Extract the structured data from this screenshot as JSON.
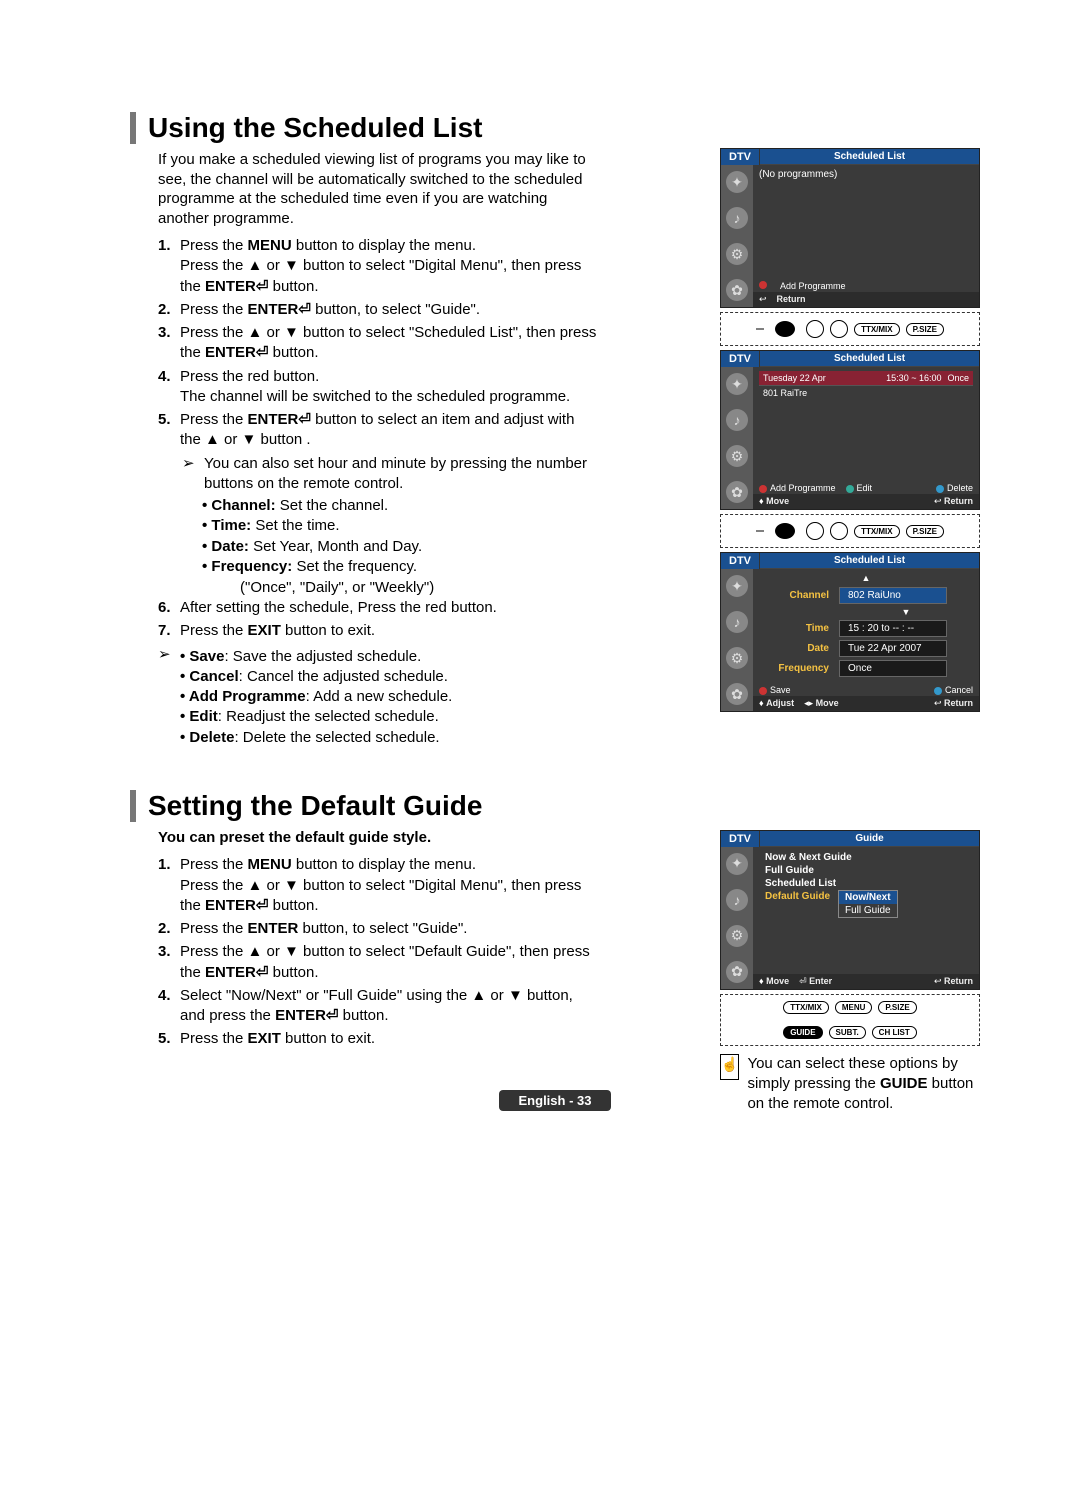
{
  "page_number": "English - 33",
  "section1": {
    "title": "Using the Scheduled List",
    "intro": "If you make a scheduled viewing list of programs you may like to see, the channel will be automatically switched to the scheduled programme at the scheduled time even if you are watching another programme.",
    "steps": {
      "s1a": "Press the ",
      "s1b": "MENU",
      "s1c": " button to display the menu.",
      "s1d": "Press the ▲ or ▼ button to select \"Digital Menu\", then press the ",
      "s1e": "ENTER",
      "s1f": " button.",
      "s2a": "Press the ",
      "s2b": "ENTER",
      "s2c": " button, to select \"Guide\".",
      "s3a": "Press the ▲ or ▼ button to select \"Scheduled List\", then press the ",
      "s3b": "ENTER",
      "s3c": " button.",
      "s4a": "Press the red button.",
      "s4b": "The channel will be switched to the scheduled programme.",
      "s5a": "Press the ",
      "s5b": "ENTER",
      "s5c": " button to select an item and adjust with the ▲ or ▼ button .",
      "s5note": "You can also set hour and minute by pressing the number buttons on the remote control.",
      "s5_b1": "Channel: Set the channel.",
      "s5_b2": "Time: Set the time.",
      "s5_b3": "Date: Set Year, Month and Day.",
      "s5_b4": "Frequency: Set the frequency.",
      "s5_freq": "(\"Once\", \"Daily\", or \"Weekly\")",
      "s6": "After setting the schedule, Press the red button.",
      "s7a": "Press the ",
      "s7b": "EXIT",
      "s7c": " button to exit.",
      "tail_b1": "Save: Save the adjusted schedule.",
      "tail_b2": "Cancel: Cancel the adjusted schedule.",
      "tail_b3": "Add Programme: Add a new schedule.",
      "tail_b4": "Edit: Readjust the selected schedule.",
      "tail_b5": "Delete: Delete the selected schedule."
    },
    "tv1": {
      "dtv": "DTV",
      "title": "Scheduled List",
      "noprog": "(No programmes)",
      "add": "Add Programme",
      "return": "Return"
    },
    "remote": {
      "ttx": "TTX/MIX",
      "psize": "P.SIZE"
    },
    "tv2": {
      "dtv": "DTV",
      "title": "Scheduled List",
      "date": "Tuesday 22 Apr",
      "time": "15:30 ~ 16:00",
      "freq": "Once",
      "ch": "801 RaiTre",
      "add": "Add Programme",
      "edit": "Edit",
      "delete": "Delete",
      "move": "Move",
      "return": "Return"
    },
    "tv3": {
      "dtv": "DTV",
      "title": "Scheduled List",
      "ch_label": "Channel",
      "ch_val": "802 RaiUno",
      "time_label": "Time",
      "time_val": "15 : 20 to -- : --",
      "date_label": "Date",
      "date_val": "Tue 22 Apr 2007",
      "freq_label": "Frequency",
      "freq_val": "Once",
      "save": "Save",
      "cancel": "Cancel",
      "adjust": "Adjust",
      "move": "Move",
      "return": "Return"
    }
  },
  "section2": {
    "title": "Setting the Default Guide",
    "intro": "You can preset the default guide style.",
    "steps": {
      "s1a": "Press the ",
      "s1b": "MENU",
      "s1c": " button to display the menu.",
      "s1d": "Press the ▲ or ▼ button to select \"Digital Menu\", then press the ",
      "s1e": "ENTER",
      "s1f": " button.",
      "s2a": "Press the ",
      "s2b": "ENTER",
      "s2c": " button, to select \"Guide\".",
      "s3a": "Press the ▲ or ▼ button to select \"Default Guide\", then press the ",
      "s3b": "ENTER",
      "s3c": " button.",
      "s4a": "Select \"Now/Next\" or \"Full Guide\" using the ▲ or ▼ button, and press the ",
      "s4b": "ENTER",
      "s4c": " button.",
      "s5a": "Press the ",
      "s5b": "EXIT",
      "s5c": " button to exit."
    },
    "tv": {
      "dtv": "DTV",
      "title": "Guide",
      "i1": "Now & Next Guide",
      "i2": "Full Guide",
      "i3": "Scheduled List",
      "i4": "Default Guide",
      "opt1": "Now/Next",
      "opt2": "Full Guide",
      "move": "Move",
      "enter": "Enter",
      "return": "Return"
    },
    "remote": {
      "ttx": "TTX/MIX",
      "menu": "MENU",
      "psize": "P.SIZE",
      "guide": "GUIDE",
      "subt": "SUBT.",
      "chlist": "CH LIST"
    },
    "tip_a": "You can select these options by simply pressing the ",
    "tip_b": "GUIDE",
    "tip_c": " button on the remote control."
  }
}
